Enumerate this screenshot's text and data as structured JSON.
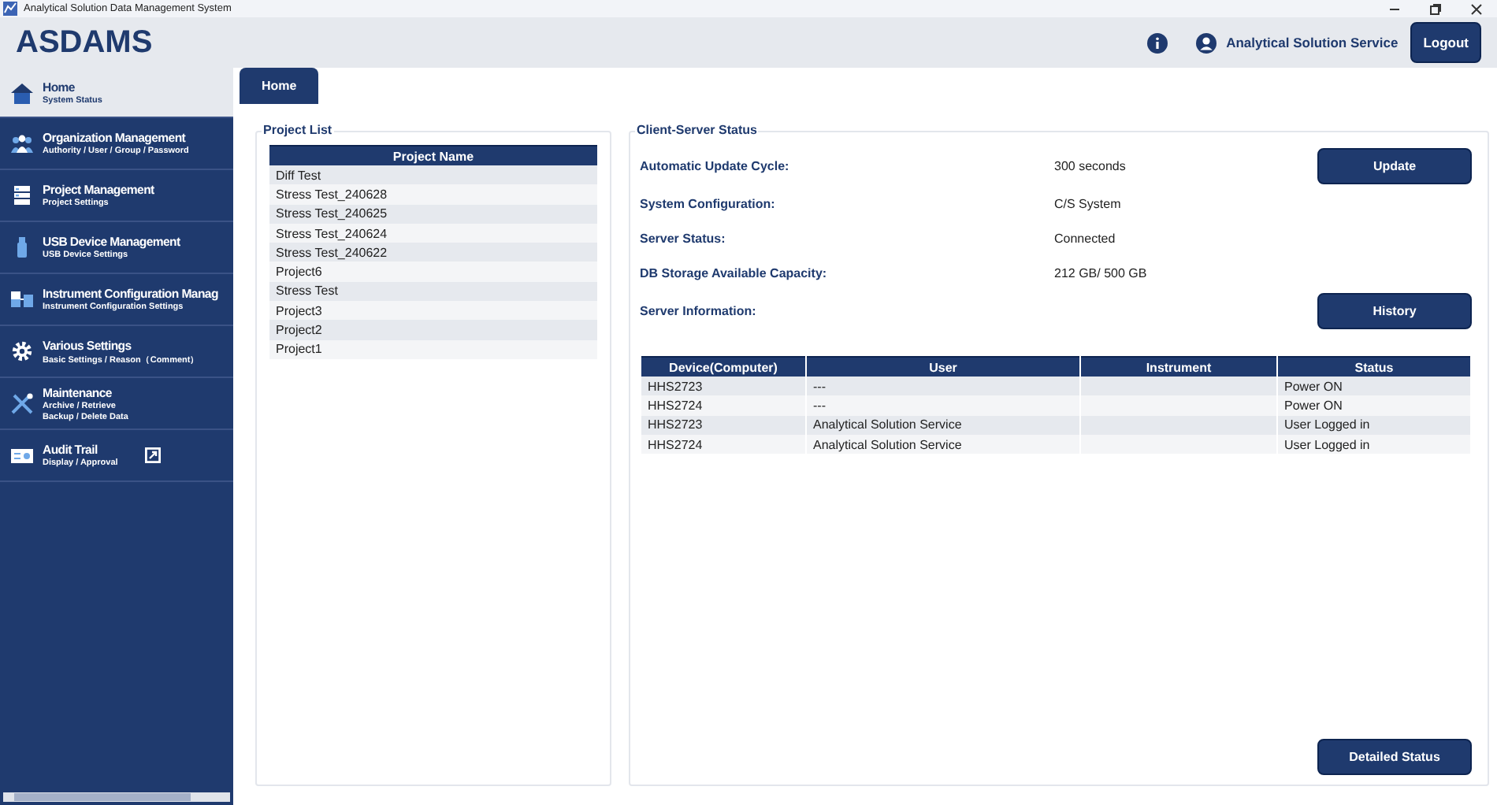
{
  "window": {
    "title": "Analytical Solution Data Management System"
  },
  "header": {
    "logo": "ASDAMS",
    "user": "Analytical Solution Service",
    "logout": "Logout"
  },
  "sidebar": {
    "items": [
      {
        "kind": "home",
        "title": "Home",
        "subtitle": [
          "System Status"
        ],
        "selected": true,
        "external": false
      },
      {
        "kind": "people",
        "title": "Organization Management",
        "subtitle": [
          "Authority / User / Group / Password"
        ],
        "selected": false,
        "external": false
      },
      {
        "kind": "server",
        "title": "Project Management",
        "subtitle": [
          "Project Settings"
        ],
        "selected": false,
        "external": false
      },
      {
        "kind": "usb",
        "title": "USB Device Management",
        "subtitle": [
          "USB Device Settings"
        ],
        "selected": false,
        "external": false
      },
      {
        "kind": "instrument",
        "title": "Instrument Configuration Manag",
        "subtitle": [
          "Instrument Configuration Settings"
        ],
        "selected": false,
        "external": false
      },
      {
        "kind": "gear",
        "title": "Various Settings",
        "subtitle": [
          "Basic Settings / Reason（Comment）"
        ],
        "selected": false,
        "external": false
      },
      {
        "kind": "tools",
        "title": "Maintenance",
        "subtitle": [
          "Archive / Retrieve",
          "Backup / Delete Data"
        ],
        "selected": false,
        "external": false
      },
      {
        "kind": "audit",
        "title": "Audit Trail",
        "subtitle": [
          "Display / Approval"
        ],
        "selected": false,
        "external": true
      }
    ]
  },
  "tabs": [
    {
      "label": "Home",
      "selected": true
    }
  ],
  "project_list": {
    "title": "Project List",
    "column": "Project Name",
    "rows": [
      "Diff Test",
      "Stress Test_240628",
      "Stress Test_240625",
      "Stress Test_240624",
      "Stress Test_240622",
      "Project6",
      "Stress Test",
      "Project3",
      "Project2",
      "Project1"
    ]
  },
  "client_server": {
    "title": "Client-Server Status",
    "fields": [
      {
        "label": "Automatic Update Cycle:",
        "value": "300 seconds",
        "button": "Update"
      },
      {
        "label": "System Configuration:",
        "value": "C/S System"
      },
      {
        "label": "Server Status:",
        "value": "Connected"
      },
      {
        "label": "DB Storage Available Capacity:",
        "value": "212 GB/ 500 GB"
      },
      {
        "label": "Server Information:",
        "button": "History"
      }
    ],
    "table": {
      "columns": [
        "Device(Computer)",
        "User",
        "Instrument",
        "Status"
      ],
      "rows": [
        [
          "HHS2723",
          "---",
          "",
          "Power ON"
        ],
        [
          "HHS2724",
          "---",
          "",
          "Power ON"
        ],
        [
          "HHS2723",
          "Analytical Solution Service",
          "",
          "User Logged in"
        ],
        [
          "HHS2724",
          "Analytical Solution Service",
          "",
          "User Logged in"
        ]
      ]
    },
    "detail_button": "Detailed Status"
  }
}
